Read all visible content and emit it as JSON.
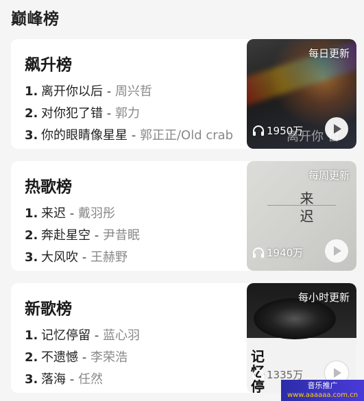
{
  "section": {
    "title": "巅峰榜"
  },
  "cards": [
    {
      "title": "飙升榜",
      "badge": "每日更新",
      "play_count": "1950万",
      "cover_text": "离开你 哲",
      "songs": [
        {
          "rank": "1.",
          "name": "离开你以后",
          "artist": "周兴哲"
        },
        {
          "rank": "2.",
          "name": "对你犯了错",
          "artist": "郭力"
        },
        {
          "rank": "3.",
          "name": "你的眼睛像星星",
          "artist": "郭正正/Old crab"
        }
      ]
    },
    {
      "title": "热歌榜",
      "badge": "每周更新",
      "play_count": "1940万",
      "cover_text": "来迟",
      "songs": [
        {
          "rank": "1.",
          "name": "来迟",
          "artist": "戴羽彤"
        },
        {
          "rank": "2.",
          "name": "奔赴星空",
          "artist": "尹昔眠"
        },
        {
          "rank": "3.",
          "name": "大风吹",
          "artist": "王赫野"
        }
      ]
    },
    {
      "title": "新歌榜",
      "badge": "每小时更新",
      "play_count": "1335万",
      "cover_text": "记忆停留",
      "songs": [
        {
          "rank": "1.",
          "name": "记忆停留",
          "artist": "蓝心羽"
        },
        {
          "rank": "2.",
          "name": "不遗憾",
          "artist": "李荣浩"
        },
        {
          "rank": "3.",
          "name": "落海",
          "artist": "任然"
        }
      ]
    }
  ],
  "separator": "-",
  "watermark": {
    "line1": "音乐推广",
    "line2": "www.aaaaaa.com.cn"
  },
  "icons": {
    "headphone": "headphone-icon",
    "play": "play-icon"
  }
}
